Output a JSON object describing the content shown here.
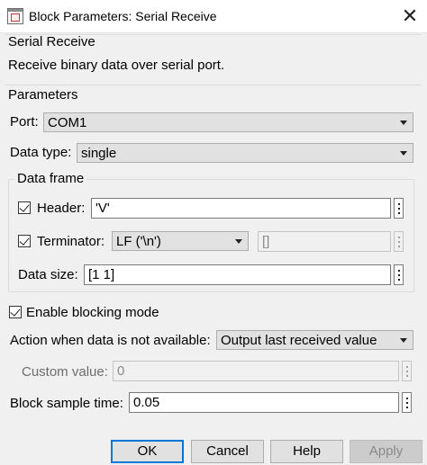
{
  "window": {
    "title": "Block Parameters: Serial Receive",
    "close_symbol": "✕"
  },
  "block": {
    "name": "Serial Receive",
    "description": "Receive binary data over serial port."
  },
  "parameters": {
    "heading": "Parameters",
    "port": {
      "label": "Port:",
      "value": "COM1"
    },
    "data_type": {
      "label": "Data type:",
      "value": "single"
    },
    "data_frame": {
      "heading": "Data frame",
      "header": {
        "label": "Header:",
        "checked": true,
        "value": "'V'"
      },
      "terminator": {
        "label": "Terminator:",
        "checked": true,
        "value": "LF ('\\n')",
        "custom_value": "[]"
      },
      "data_size": {
        "label": "Data size:",
        "value": "[1 1]"
      }
    },
    "enable_blocking": {
      "label": "Enable blocking mode",
      "checked": true
    },
    "action": {
      "label": "Action when data is not available:",
      "value": "Output last received value"
    },
    "custom_value": {
      "label": "Custom value:",
      "value": "0"
    },
    "sample_time": {
      "label": "Block sample time:",
      "value": "0.05"
    }
  },
  "buttons": {
    "ok": "OK",
    "cancel": "Cancel",
    "help": "Help",
    "apply": "Apply"
  },
  "colors": {
    "default_button_border": "#0078d7",
    "dialog_background": "#f0f0f0"
  }
}
